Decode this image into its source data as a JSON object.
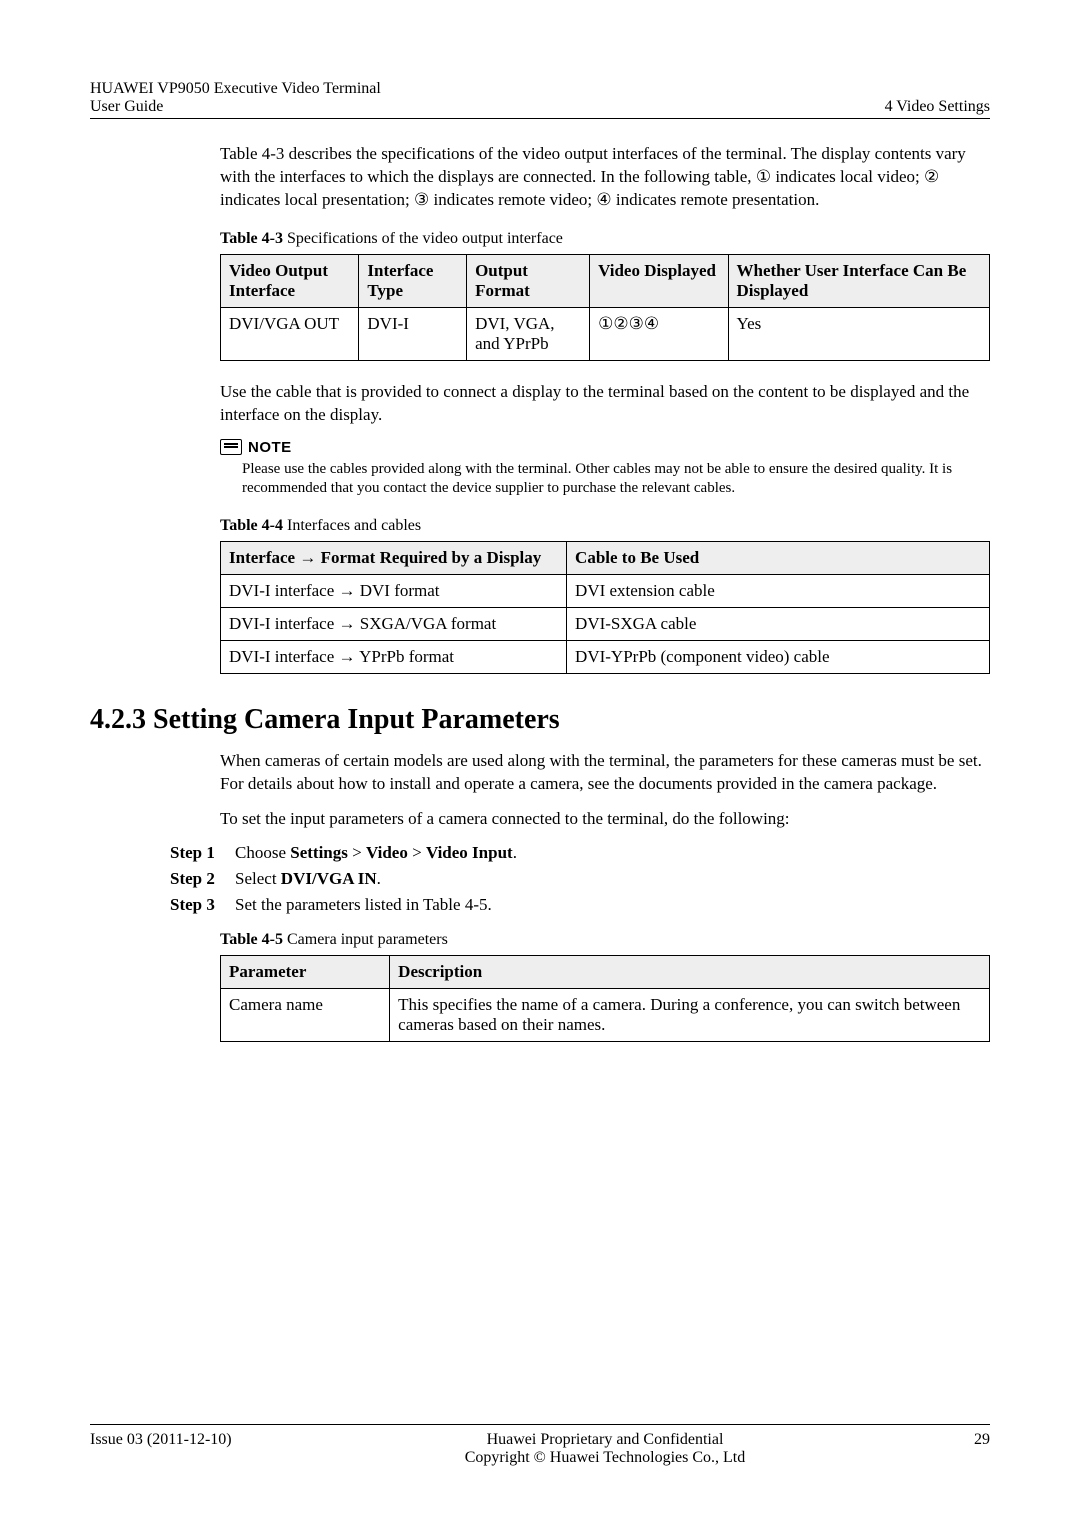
{
  "header": {
    "product": "HUAWEI VP9050 Executive Video Terminal",
    "doc": "User Guide",
    "chapter": "4 Video Settings"
  },
  "intro": {
    "p1_a": "Table 4-3 describes the specifications of the video output interfaces of the terminal. The display contents vary with the interfaces to which the displays are connected. In the following table, ",
    "c1": "①",
    "p1_b": " indicates local video; ",
    "c2": "②",
    "p1_c": " indicates local presentation; ",
    "c3": "③",
    "p1_d": " indicates remote video; ",
    "c4": "④",
    "p1_e": " indicates remote presentation."
  },
  "table43": {
    "caption_bold": "Table 4-3",
    "caption_rest": " Specifications of the video output interface",
    "h1": "Video Output Interface",
    "h2": "Interface Type",
    "h3": "Output Format",
    "h4": "Video Displayed",
    "h5": "Whether User Interface Can Be Displayed",
    "r1c1": "DVI/VGA OUT",
    "r1c2": "DVI-I",
    "r1c3": "DVI, VGA, and YPrPb",
    "r1c4": "①②③④",
    "r1c5": "Yes"
  },
  "para2": "Use the cable that is provided to connect a display to the terminal based on the content to be displayed and the interface on the display.",
  "note": {
    "label": "NOTE",
    "body": "Please use the cables provided along with the terminal. Other cables may not be able to ensure the desired quality. It is recommended that you contact the device supplier to purchase the relevant cables."
  },
  "table44": {
    "caption_bold": "Table 4-4",
    "caption_rest": " Interfaces and cables",
    "h1": "Interface → Format Required by a Display",
    "h2": "Cable to Be Used",
    "r1c1": "DVI-I interface → DVI format",
    "r1c2": "DVI extension cable",
    "r2c1": "DVI-I interface → SXGA/VGA format",
    "r2c2": "DVI-SXGA cable",
    "r3c1": "DVI-I interface → YPrPb format",
    "r3c2": "DVI-YPrPb (component video) cable"
  },
  "section": {
    "title": "4.2.3 Setting Camera Input Parameters",
    "p1": "When cameras of certain models are used along with the terminal, the parameters for these cameras must be set. For details about how to install and operate a camera, see the documents provided in the camera package.",
    "p2": "To set the input parameters of a camera connected to the terminal, do the following:",
    "step1_label": "Step 1",
    "step1_a": "Choose ",
    "step1_b1": "Settings",
    "step1_sep": " > ",
    "step1_b2": "Video",
    "step1_b3": "Video Input",
    "step1_end": ".",
    "step2_label": "Step 2",
    "step2_a": "Select ",
    "step2_b": "DVI/VGA IN",
    "step2_end": ".",
    "step3_label": "Step 3",
    "step3_a": "Set the parameters listed in Table 4-5."
  },
  "table45": {
    "caption_bold": "Table 4-5",
    "caption_rest": " Camera input parameters",
    "h1": "Parameter",
    "h2": "Description",
    "r1c1": "Camera name",
    "r1c2": "This specifies the name of a camera. During a conference, you can switch between cameras based on their names."
  },
  "footer": {
    "issue": "Issue 03 (2011-12-10)",
    "center1": "Huawei Proprietary and Confidential",
    "center2": "Copyright © Huawei Technologies Co., Ltd",
    "page": "29"
  },
  "chart_data": [
    {
      "type": "table",
      "title": "Table 4-3 Specifications of the video output interface",
      "columns": [
        "Video Output Interface",
        "Interface Type",
        "Output Format",
        "Video Displayed",
        "Whether User Interface Can Be Displayed"
      ],
      "rows": [
        [
          "DVI/VGA OUT",
          "DVI-I",
          "DVI, VGA, and YPrPb",
          "①②③④",
          "Yes"
        ]
      ]
    },
    {
      "type": "table",
      "title": "Table 4-4 Interfaces and cables",
      "columns": [
        "Interface → Format Required by a Display",
        "Cable to Be Used"
      ],
      "rows": [
        [
          "DVI-I interface → DVI format",
          "DVI extension cable"
        ],
        [
          "DVI-I interface → SXGA/VGA format",
          "DVI-SXGA cable"
        ],
        [
          "DVI-I interface → YPrPb format",
          "DVI-YPrPb (component video) cable"
        ]
      ]
    },
    {
      "type": "table",
      "title": "Table 4-5 Camera input parameters",
      "columns": [
        "Parameter",
        "Description"
      ],
      "rows": [
        [
          "Camera name",
          "This specifies the name of a camera. During a conference, you can switch between cameras based on their names."
        ]
      ]
    }
  ]
}
